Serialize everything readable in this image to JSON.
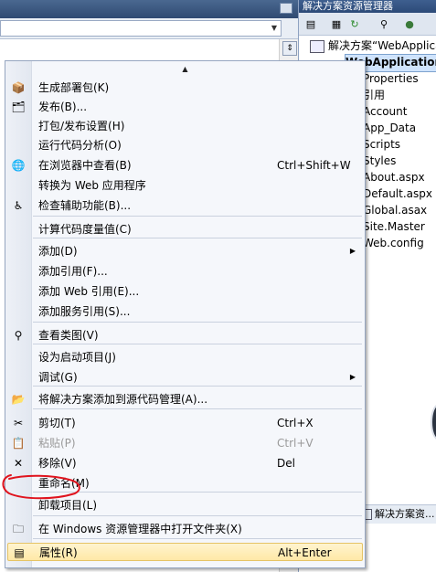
{
  "solution_explorer": {
    "title": "解决方案资源管理器",
    "solution_label": "解决方案“WebApplica",
    "project_label": "WebApplication",
    "items": [
      "Properties",
      "引用",
      "Account",
      "App_Data",
      "Scripts",
      "Styles",
      "About.aspx",
      "Default.aspx",
      "Global.asax",
      "Site.Master",
      "Web.config"
    ],
    "bottom_tab": "解决方案资..."
  },
  "context_menu": {
    "items": [
      {
        "label": "生成部署包(K)",
        "shortcut": "",
        "icon": "package-icon",
        "submenu": false,
        "disabled": false
      },
      {
        "label": "发布(B)...",
        "shortcut": "",
        "icon": "publish-icon",
        "submenu": false,
        "disabled": false
      },
      {
        "label": "打包/发布设置(H)",
        "shortcut": "",
        "icon": "",
        "submenu": false,
        "disabled": false
      },
      {
        "label": "运行代码分析(O)",
        "shortcut": "",
        "icon": "",
        "submenu": false,
        "disabled": false
      },
      {
        "label": "在浏览器中查看(B)",
        "shortcut": "Ctrl+Shift+W",
        "icon": "browser-icon",
        "submenu": false,
        "disabled": false
      },
      {
        "label": "转换为 Web 应用程序",
        "shortcut": "",
        "icon": "",
        "submenu": false,
        "disabled": false
      },
      {
        "label": "检查辅助功能(B)...",
        "shortcut": "",
        "icon": "accessibility-icon",
        "submenu": false,
        "disabled": false
      },
      {
        "label": "计算代码度量值(C)",
        "shortcut": "",
        "icon": "",
        "submenu": false,
        "disabled": false
      },
      {
        "label": "添加(D)",
        "shortcut": "",
        "icon": "",
        "submenu": true,
        "disabled": false
      },
      {
        "label": "添加引用(F)...",
        "shortcut": "",
        "icon": "",
        "submenu": false,
        "disabled": false
      },
      {
        "label": "添加 Web 引用(E)...",
        "shortcut": "",
        "icon": "",
        "submenu": false,
        "disabled": false
      },
      {
        "label": "添加服务引用(S)...",
        "shortcut": "",
        "icon": "",
        "submenu": false,
        "disabled": false
      },
      {
        "label": "查看类图(V)",
        "shortcut": "",
        "icon": "class-diagram-icon",
        "submenu": false,
        "disabled": false
      },
      {
        "label": "设为启动项目(J)",
        "shortcut": "",
        "icon": "",
        "submenu": false,
        "disabled": false
      },
      {
        "label": "调试(G)",
        "shortcut": "",
        "icon": "",
        "submenu": true,
        "disabled": false
      },
      {
        "label": "将解决方案添加到源代码管理(A)...",
        "shortcut": "",
        "icon": "source-control-icon",
        "submenu": false,
        "disabled": false
      },
      {
        "label": "剪切(T)",
        "shortcut": "Ctrl+X",
        "icon": "cut-icon",
        "submenu": false,
        "disabled": false
      },
      {
        "label": "粘贴(P)",
        "shortcut": "Ctrl+V",
        "icon": "paste-icon",
        "submenu": false,
        "disabled": true
      },
      {
        "label": "移除(V)",
        "shortcut": "Del",
        "icon": "remove-icon",
        "submenu": false,
        "disabled": false
      },
      {
        "label": "重命名(M)",
        "shortcut": "",
        "icon": "",
        "submenu": false,
        "disabled": false
      },
      {
        "label": "卸载项目(L)",
        "shortcut": "",
        "icon": "",
        "submenu": false,
        "disabled": false
      },
      {
        "label": "在 Windows 资源管理器中打开文件夹(X)",
        "shortcut": "",
        "icon": "open-folder-icon",
        "submenu": false,
        "disabled": false
      },
      {
        "label": "属性(R)",
        "shortcut": "Alt+Enter",
        "icon": "properties-icon",
        "submenu": false,
        "disabled": false
      }
    ]
  },
  "colors": {
    "menu_background": "#f5f7fb",
    "hover_background": "#ffe8a6",
    "annotation_red": "#e0141e",
    "panel_title": "#2c4a78"
  }
}
